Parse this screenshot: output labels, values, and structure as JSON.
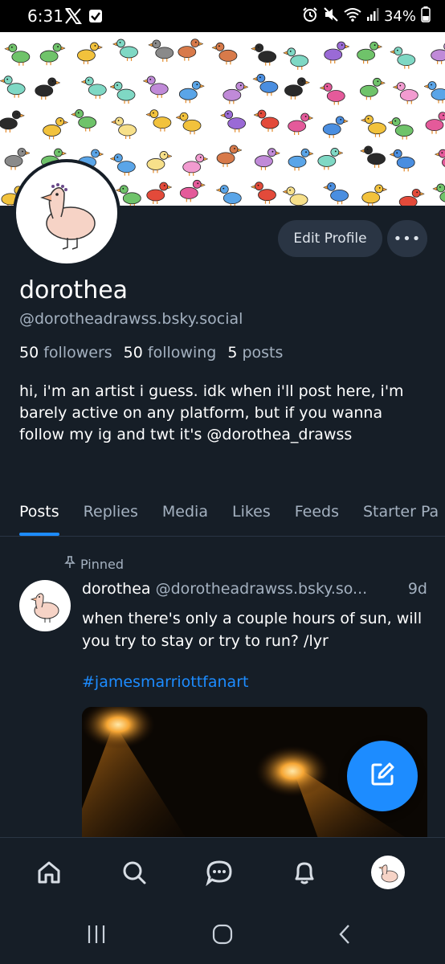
{
  "status": {
    "time": "6:31",
    "battery": "34%"
  },
  "profile": {
    "display_name": "dorothea",
    "handle": "@dorotheadrawss.bsky.social",
    "followers_count": "50",
    "followers_label": "followers",
    "following_count": "50",
    "following_label": "following",
    "posts_count": "5",
    "posts_label": "posts",
    "bio": "hi, i'm an artist i guess. idk when i'll post here, i'm barely active on any platform, but if you wanna follow my ig and twt it's @dorothea_drawss",
    "edit_label": "Edit Profile",
    "more_label": "•••"
  },
  "tabs": [
    {
      "label": "Posts",
      "active": true
    },
    {
      "label": "Replies"
    },
    {
      "label": "Media"
    },
    {
      "label": "Likes"
    },
    {
      "label": "Feeds"
    },
    {
      "label": "Starter Pa"
    }
  ],
  "post": {
    "pinned_label": "Pinned",
    "author_name": "dorothea",
    "author_handle": "@dorotheadrawss.bsky.so...",
    "age": "9d",
    "text": "when there's only a couple hours of sun, will you try to stay or try to run? /lyr",
    "hashtag": "#jamesmarriottfanart"
  },
  "colors": {
    "accent": "#1d8cff",
    "background": "#161e27",
    "muted": "#a4b1c0"
  },
  "icons": [
    "x-icon",
    "check-icon",
    "alarm-icon",
    "mute-icon",
    "wifi-icon",
    "signal-icon",
    "battery-icon",
    "pin-icon",
    "compose-icon",
    "home-icon",
    "search-icon",
    "chat-icon",
    "bell-icon",
    "recents-icon",
    "home-sys-icon",
    "back-icon"
  ]
}
